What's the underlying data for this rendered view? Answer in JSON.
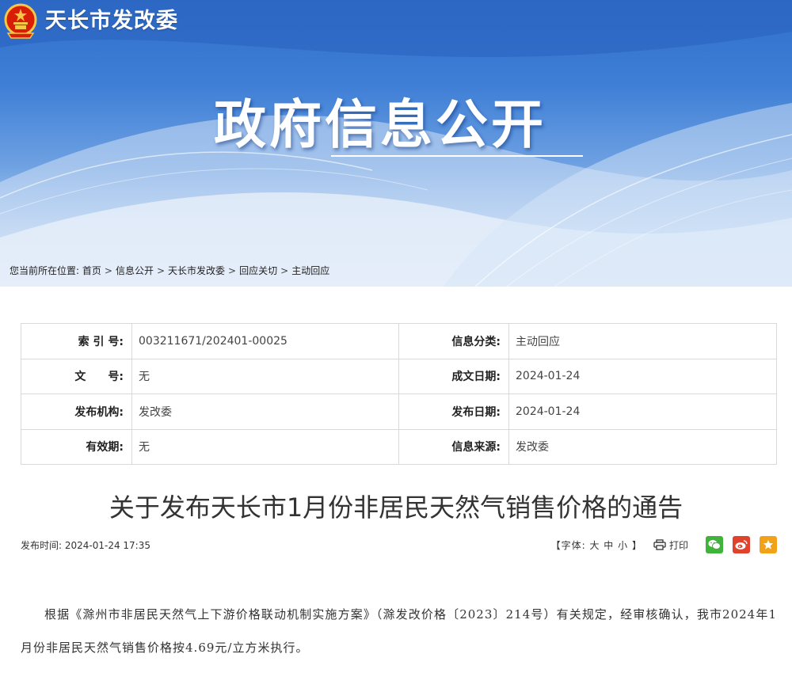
{
  "header": {
    "site_name": "天长市发改委",
    "banner_title": "政府信息公开"
  },
  "breadcrumb": {
    "prefix": "您当前所在位置:",
    "items": [
      "首页",
      "信息公开",
      "天长市发改委",
      "回应关切",
      "主动回应"
    ]
  },
  "info": {
    "index_label": "索 引 号:",
    "index_value": "003211671/202401-00025",
    "category_label": "信息分类:",
    "category_value": "主动回应",
    "doc_no_label": "文　　号:",
    "doc_no_value": "无",
    "created_label": "成文日期:",
    "created_value": "2024-01-24",
    "publisher_label": "发布机构:",
    "publisher_value": "发改委",
    "pub_date_label": "发布日期:",
    "pub_date_value": "2024-01-24",
    "validity_label": "有效期:",
    "validity_value": "无",
    "source_label": "信息来源:",
    "source_value": "发改委"
  },
  "article": {
    "title": "关于发布天长市1月份非居民天然气销售价格的通告",
    "publish_time": "发布时间: 2024-01-24 17:35",
    "font_prefix": "【字体:",
    "font_large": "大",
    "font_medium": "中",
    "font_small": "小",
    "font_suffix": "】",
    "print_label": "打印",
    "body": "根据《滁州市非居民天然气上下游价格联动机制实施方案》（滁发改价格〔2023〕214号）有关规定，经审核确认，我市2024年1月份非居民天然气销售价格按4.69元/立方米执行。"
  },
  "icons": {
    "emblem": "national-emblem-icon",
    "print": "printer-icon",
    "wechat": "wechat-icon",
    "weibo": "weibo-icon",
    "favorite": "star-icon"
  },
  "colors": {
    "banner_blue": "#2f6fcb",
    "wechat": "#3fb33a",
    "weibo": "#e0422c",
    "favorite": "#f2a219"
  }
}
